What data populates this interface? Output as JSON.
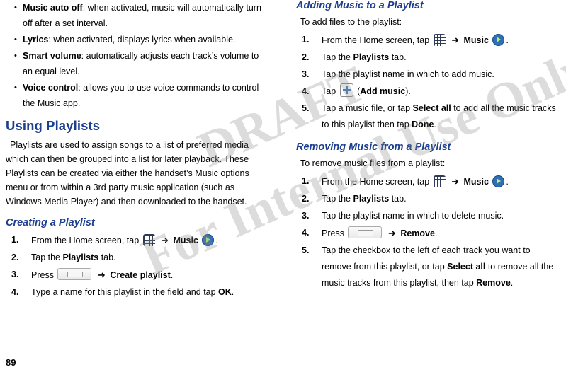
{
  "page": {
    "number": "89",
    "watermark_line1": "DRAFT",
    "watermark_line2": "For Internal Use Only"
  },
  "left_column": {
    "bullets": [
      {
        "term": "Music auto off",
        "text": ": when activated, music will automatically turn off after a set interval."
      },
      {
        "term": "Lyrics",
        "text": ": when activated, displays lyrics when available."
      },
      {
        "term": "Smart volume",
        "text": ": automatically adjusts each track’s volume to an equal level."
      },
      {
        "term": "Voice control",
        "text": ": allows you to use voice commands to control the Music app."
      }
    ],
    "section_title": "Using Playlists",
    "intro_paragraph": "Playlists are used to assign songs to a list of preferred media which can then be grouped into a list for later playback. These Playlists can be created via either the handset’s Music options menu or from within a 3rd party music application (such as Windows Media Player) and then downloaded to the handset.",
    "creating_title": "Creating a Playlist",
    "creating_steps": [
      {
        "num": "1.",
        "parts": [
          "From the Home screen, tap ",
          "{apps-icon}",
          " ",
          "{arrow}",
          " ",
          "{b:Music}",
          " ",
          "{music-icon}",
          "."
        ]
      },
      {
        "num": "2.",
        "parts": [
          "Tap the ",
          "{b:Playlists}",
          " tab."
        ]
      },
      {
        "num": "3.",
        "parts": [
          "Press ",
          "{menu-icon}",
          " ",
          "{arrow}",
          " ",
          "{b:Create playlist}",
          "."
        ]
      },
      {
        "num": "4.",
        "parts": [
          "Type a name for this playlist in the field and tap ",
          "{b:OK}",
          "."
        ]
      }
    ]
  },
  "right_column": {
    "adding_title": "Adding Music to a Playlist",
    "adding_intro": "To add files to the playlist:",
    "adding_steps": [
      {
        "num": "1.",
        "parts": [
          "From the Home screen, tap ",
          "{apps-icon}",
          " ",
          "{arrow}",
          " ",
          "{b:Music}",
          " ",
          "{music-icon}",
          "."
        ]
      },
      {
        "num": "2.",
        "parts": [
          "Tap the ",
          "{b:Playlists}",
          " tab."
        ]
      },
      {
        "num": "3.",
        "parts": [
          "Tap the playlist name in which to add music."
        ]
      },
      {
        "num": "4.",
        "parts": [
          "Tap ",
          "{plus-icon}",
          " (",
          "{b:Add music}",
          ")."
        ]
      },
      {
        "num": "5.",
        "parts": [
          "Tap a music file, or tap ",
          "{b:Select all}",
          " to add all the music tracks to this playlist then tap ",
          "{b:Done}",
          "."
        ]
      }
    ],
    "removing_title": "Removing Music from a Playlist",
    "removing_intro": "To remove music files from a playlist:",
    "removing_steps": [
      {
        "num": "1.",
        "parts": [
          "From the Home screen, tap ",
          "{apps-icon}",
          " ",
          "{arrow}",
          " ",
          "{b:Music}",
          " ",
          "{music-icon}",
          "."
        ]
      },
      {
        "num": "2.",
        "parts": [
          "Tap the ",
          "{b:Playlists}",
          " tab."
        ]
      },
      {
        "num": "3.",
        "parts": [
          "Tap the playlist name in which to delete music."
        ]
      },
      {
        "num": "4.",
        "parts": [
          "Press ",
          "{menu-icon}",
          " ",
          "{arrow}",
          " ",
          "{b:Remove}",
          "."
        ]
      },
      {
        "num": "5.",
        "parts": [
          "Tap the checkbox to the left of each track you want to remove from this playlist, or tap ",
          "{b:Select all}",
          " to remove all the music tracks from this playlist, then tap ",
          "{b:Remove}",
          "."
        ]
      }
    ]
  },
  "icons": {
    "apps": "apps-grid-icon",
    "music": "music-player-icon",
    "plus": "add-music-icon",
    "menu": "menu-key-icon",
    "arrow": "➜"
  },
  "colors": {
    "heading": "#1d3f8f",
    "text": "#000000"
  }
}
